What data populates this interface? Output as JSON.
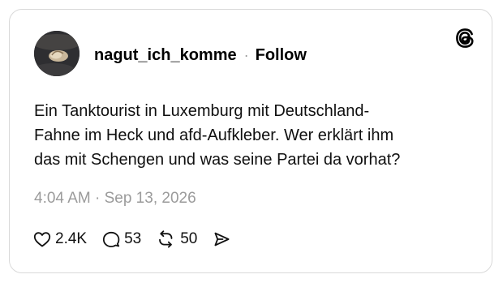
{
  "post": {
    "username": "nagut_ich_komme",
    "separator": "·",
    "follow_label": "Follow",
    "text_lines": [
      "Ein Tanktourist in Luxemburg mit Deutschland-",
      "Fahne im Heck und afd-Aufkleber. Wer erklärt ihm",
      "das mit Schengen und was seine Partei da vorhat?"
    ],
    "timestamp": "4:04 AM · Sep 13, 2026",
    "likes": "2.4K",
    "replies": "53",
    "reposts": "50"
  },
  "icons": {
    "brand": "threads-logo-icon",
    "like": "heart-icon",
    "reply": "speech-bubble-icon",
    "repost": "repost-arrows-icon",
    "share": "send-arrow-icon",
    "avatar": "user-avatar"
  },
  "colors": {
    "text": "#101010",
    "muted": "#9b9b9b",
    "border": "#d9d9d9",
    "background": "#ffffff"
  }
}
